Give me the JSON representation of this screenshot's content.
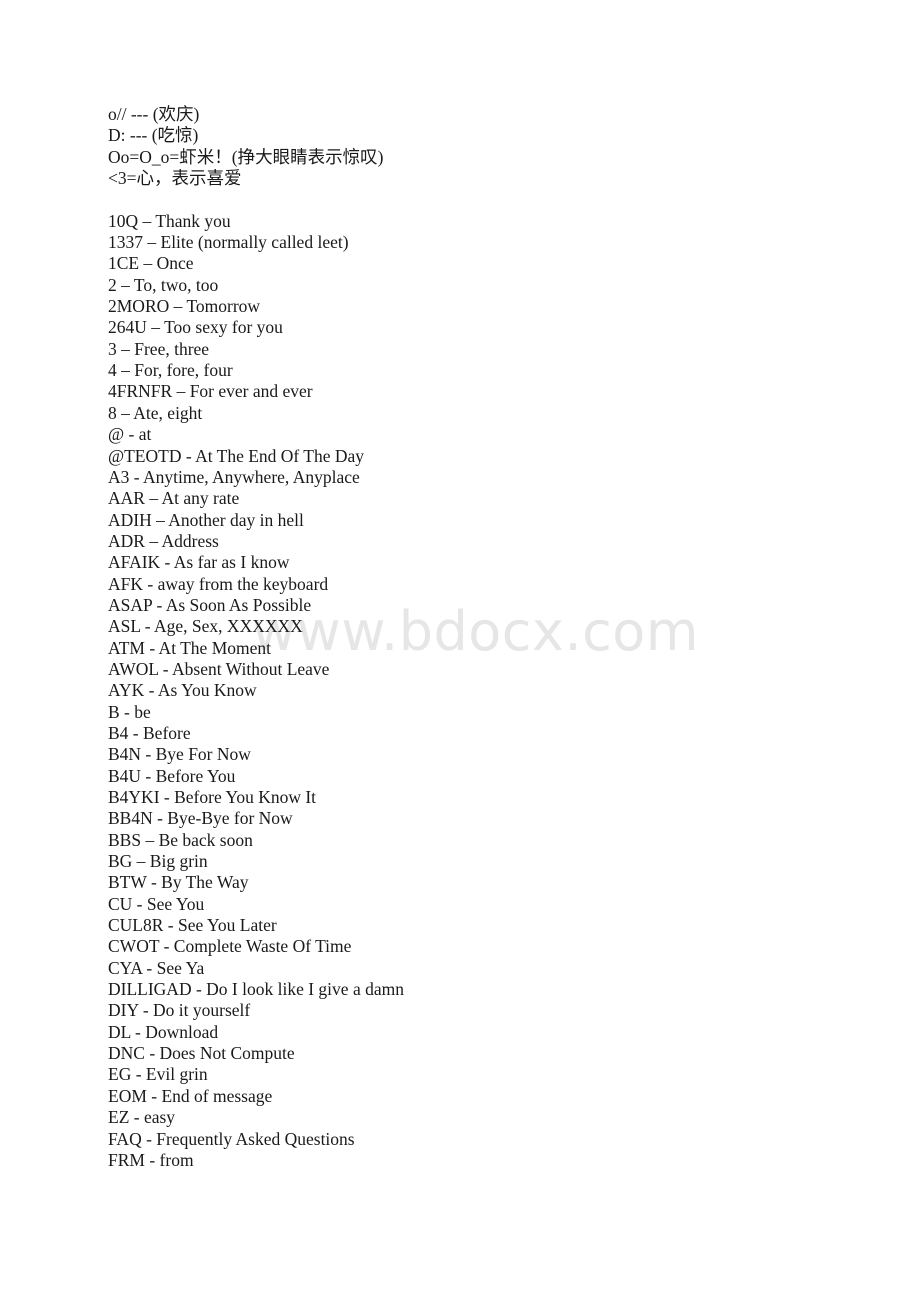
{
  "document": {
    "watermark": "www.bdocx.com",
    "emoticon_lines": [
      "o// --- (欢庆)",
      "D: --- (吃惊)",
      "Oo=O_o=虾米！(挣大眼睛表示惊叹)",
      "<3=心，表示喜爱"
    ],
    "abbreviation_lines": [
      "10Q – Thank you",
      "1337 – Elite (normally called leet)",
      "1CE – Once",
      "2 – To, two, too",
      "2MORO – Tomorrow",
      "264U – Too sexy for you",
      "3 – Free, three",
      "4 – For, fore, four",
      "4FRNFR – For ever and ever",
      "8 – Ate, eight",
      "@ - at",
      "@TEOTD - At The End Of The Day",
      "A3 - Anytime, Anywhere, Anyplace",
      "AAR – At any rate",
      "ADIH – Another day in hell",
      "ADR – Address",
      "AFAIK - As far as I know",
      "AFK - away from the keyboard",
      "ASAP - As Soon As Possible",
      "ASL - Age, Sex, XXXXXX",
      "ATM - At The Moment",
      "AWOL - Absent Without Leave",
      "AYK - As You Know",
      "B - be",
      "B4 - Before",
      "B4N - Bye For Now",
      "B4U - Before You",
      "B4YKI - Before You Know It",
      "BB4N - Bye-Bye for Now",
      "BBS – Be back soon",
      "BG – Big grin",
      "BTW - By The Way",
      "CU - See You",
      "CUL8R - See You Later",
      "CWOT - Complete Waste Of Time",
      "CYA - See Ya",
      "DILLIGAD - Do I look like I give a damn",
      "DIY - Do it yourself",
      "DL - Download",
      "DNC - Does Not Compute",
      "EG - Evil grin",
      "EOM - End of message",
      "EZ - easy",
      "FAQ - Frequently Asked Questions",
      "FRM - from"
    ]
  }
}
